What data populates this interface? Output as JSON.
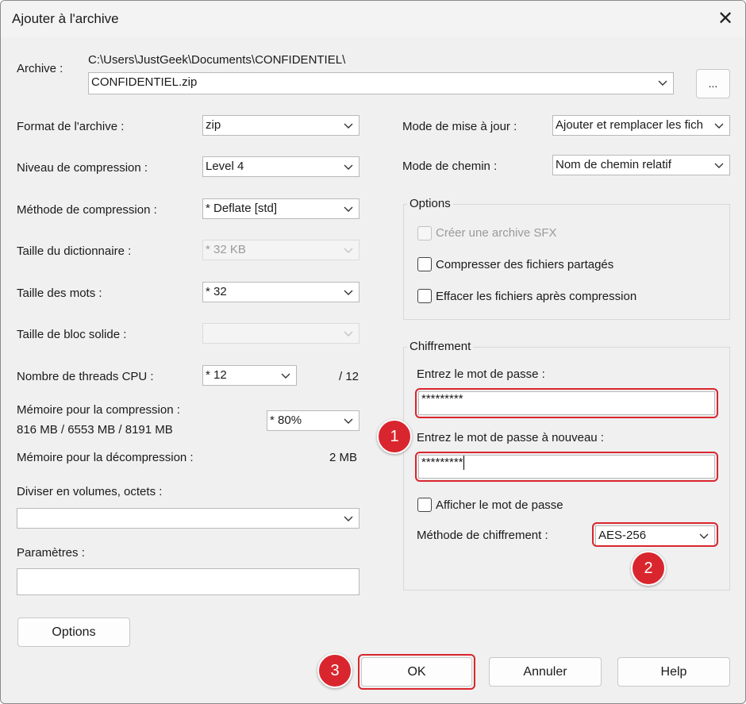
{
  "window": {
    "title": "Ajouter à l'archive"
  },
  "archive": {
    "label": "Archive :",
    "path": "C:\\Users\\JustGeek\\Documents\\CONFIDENTIEL\\",
    "filename": "CONFIDENTIEL.zip",
    "browse_label": "..."
  },
  "left": {
    "format": {
      "label": "Format de l'archive :",
      "value": "zip"
    },
    "level": {
      "label": "Niveau de compression :",
      "value": "Level 4"
    },
    "method": {
      "label": "Méthode de compression :",
      "value": "*  Deflate [std]"
    },
    "dict": {
      "label": "Taille du dictionnaire :",
      "value": "*  32 KB"
    },
    "words": {
      "label": "Taille des mots :",
      "value": "*  32"
    },
    "solid": {
      "label": "Taille de bloc solide :",
      "value": ""
    },
    "threads": {
      "label": "Nombre de threads CPU :",
      "value": "*  12",
      "max": "/ 12"
    },
    "mem_comp": {
      "label": "Mémoire pour la compression :",
      "detail": "816 MB / 6553 MB / 8191 MB",
      "value": "* 80%"
    },
    "mem_decomp": {
      "label": "Mémoire pour la décompression :",
      "value": "2 MB"
    },
    "volumes": {
      "label": "Diviser en volumes, octets :",
      "value": ""
    },
    "params": {
      "label": "Paramètres :",
      "value": ""
    },
    "options_button": "Options"
  },
  "right": {
    "update_mode": {
      "label": "Mode de mise à jour :",
      "value": "Ajouter et remplacer les fich"
    },
    "path_mode": {
      "label": "Mode de chemin :",
      "value": "Nom de chemin relatif"
    },
    "options_group": {
      "title": "Options",
      "sfx": "Créer une archive SFX",
      "shared": "Compresser des fichiers partagés",
      "delete": "Effacer les fichiers après compression"
    },
    "encryption": {
      "title": "Chiffrement",
      "password_label": "Entrez le mot de passe :",
      "password_value": "*********",
      "password2_label": "Entrez le mot de passe à nouveau :",
      "password2_value": "*********",
      "show_password": "Afficher le mot de passe",
      "method_label": "Méthode de chiffrement :",
      "method_value": "AES-256"
    }
  },
  "buttons": {
    "ok": "OK",
    "cancel": "Annuler",
    "help": "Help"
  },
  "annotations": {
    "badge1": "1",
    "badge2": "2",
    "badge3": "3"
  },
  "colors": {
    "highlight": "#d9262e",
    "dialog_bg": "#f0f0f0"
  }
}
